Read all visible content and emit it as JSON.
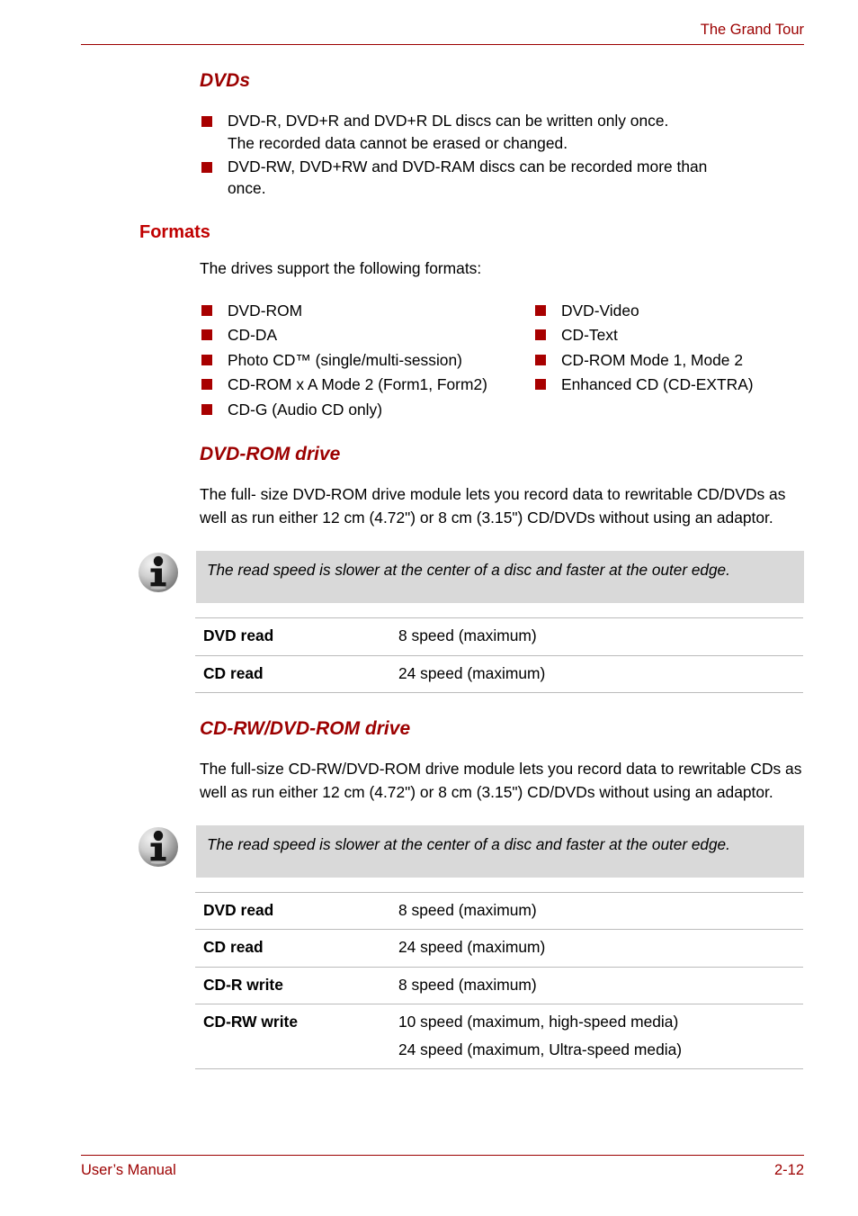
{
  "header": {
    "title": "The Grand Tour"
  },
  "sections": {
    "dvds": {
      "heading": "DVDs",
      "bullets": [
        "DVD-R, DVD+R and DVD+R DL discs can be written only once.\nThe recorded data cannot be erased or changed.",
        "DVD-RW, DVD+RW and DVD-RAM discs can be recorded more than\nonce."
      ]
    },
    "formats": {
      "heading": "Formats",
      "intro": "The drives support the following formats:",
      "rows": [
        {
          "left": "DVD-ROM",
          "right": "DVD-Video"
        },
        {
          "left": "CD-DA",
          "right": "CD-Text"
        },
        {
          "left": "Photo CD™ (single/multi-session)",
          "right": "CD-ROM Mode 1, Mode 2"
        },
        {
          "left": "CD-ROM x A Mode 2 (Form1, Form2)",
          "right": "Enhanced CD (CD-EXTRA)"
        },
        {
          "left": "CD-G (Audio CD only)",
          "right": ""
        }
      ]
    },
    "dvd_rom_drive": {
      "heading": "DVD-ROM drive",
      "paragraph": "The full- size DVD-ROM drive module lets you record data to rewritable CD/DVDs as well as run either 12 cm (4.72\") or 8 cm (3.15\") CD/DVDs without using an adaptor.",
      "note": "The read speed is slower at the center of a disc and faster at the outer edge.",
      "note_icon": "info-icon",
      "table": [
        {
          "label": "DVD read",
          "values": [
            "8 speed (maximum)"
          ]
        },
        {
          "label": "CD read",
          "values": [
            "24 speed (maximum)"
          ]
        }
      ]
    },
    "cdrw_dvd_rom_drive": {
      "heading": "CD-RW/DVD-ROM drive",
      "paragraph": "The full-size CD-RW/DVD-ROM drive module lets you record data to rewritable CDs as well as run either 12 cm (4.72\") or 8 cm (3.15\") CD/DVDs without using an adaptor.",
      "note": "The read speed is slower at the center of a disc and faster at the outer edge.",
      "note_icon": "info-icon",
      "table": [
        {
          "label": "DVD read",
          "values": [
            "8 speed (maximum)"
          ]
        },
        {
          "label": "CD read",
          "values": [
            "24 speed (maximum)"
          ]
        },
        {
          "label": "CD-R write",
          "values": [
            "8 speed (maximum)"
          ]
        },
        {
          "label": "CD-RW write",
          "values": [
            "10 speed (maximum, high-speed media)",
            "24 speed (maximum, Ultra-speed media)"
          ]
        }
      ]
    }
  },
  "footer": {
    "left": "User’s Manual",
    "right": "2-12"
  },
  "colors": {
    "accent_red": "#9c0000",
    "heading_red": "#c00000",
    "bullet_red": "#a80000",
    "note_bg": "#d9d9d9",
    "rule_gray": "#bbbbbb"
  }
}
